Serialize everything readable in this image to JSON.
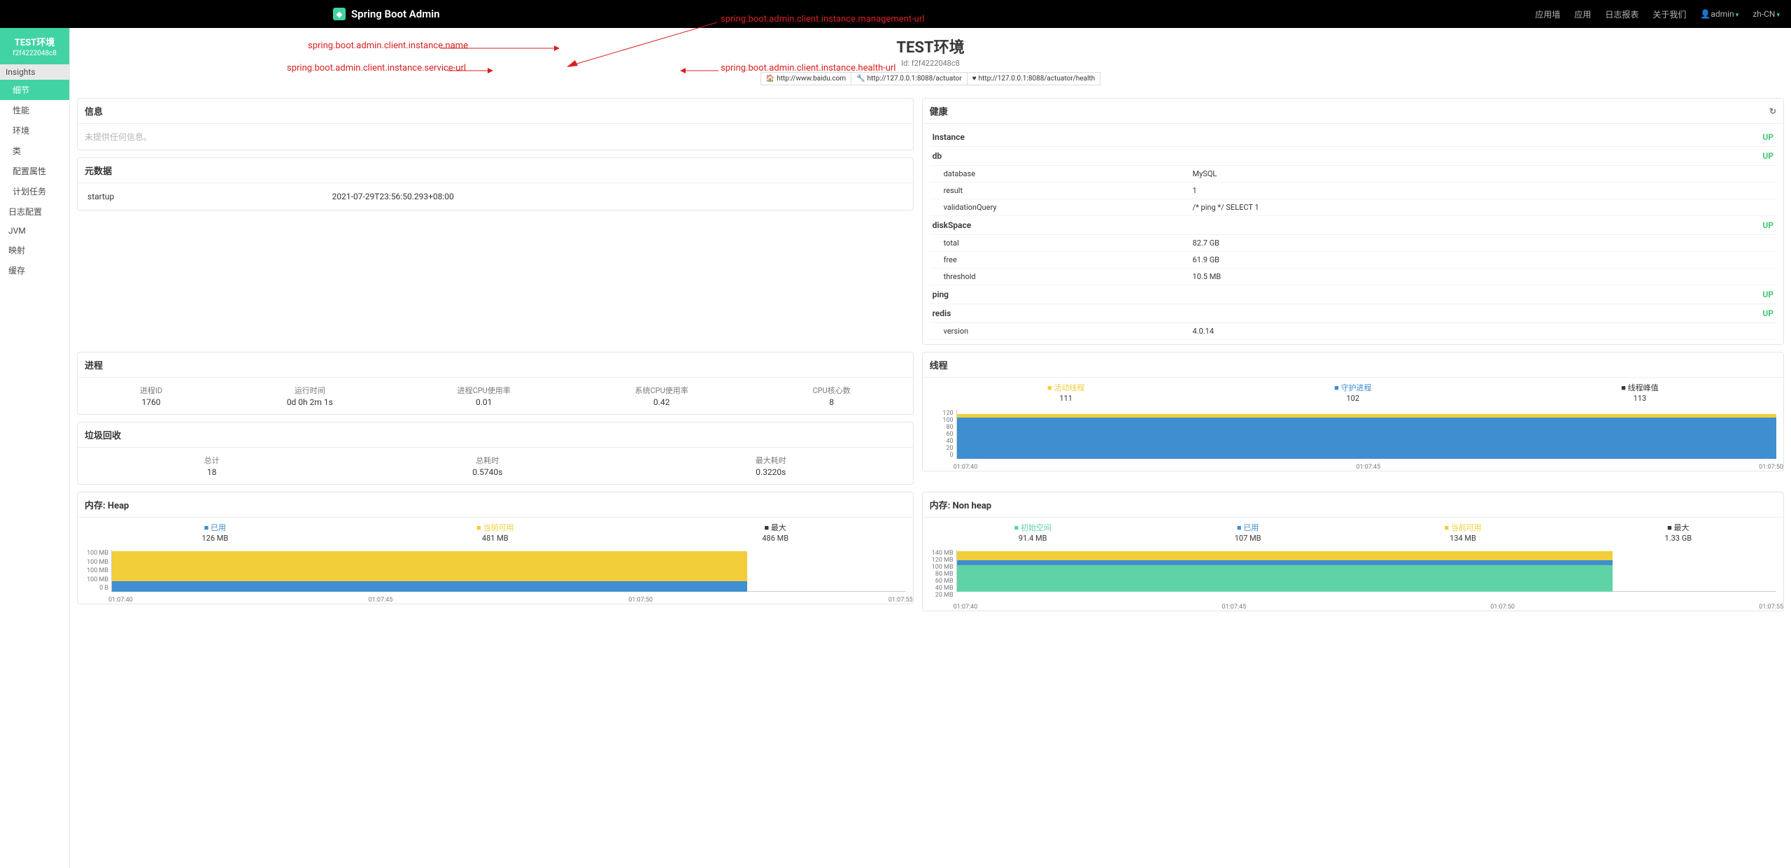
{
  "navbar": {
    "brand": "Spring Boot Admin",
    "items": [
      "应用墙",
      "应用",
      "日志报表",
      "关于我们"
    ],
    "user": "admin",
    "lang": "zh-CN"
  },
  "sidebar": {
    "app_title": "TEST环境",
    "app_id": "f2f4222048c8",
    "section": "Insights",
    "items": [
      "细节",
      "性能",
      "环境",
      "类",
      "配置属性",
      "计划任务",
      "日志配置",
      "JVM",
      "映射",
      "缓存"
    ]
  },
  "header": {
    "title": "TEST环境",
    "sub": "Id: f2f4222048c8",
    "urls": {
      "service": "http://www.baidu.com",
      "management": "http://127.0.0.1:8088/actuator",
      "health": "http://127.0.0.1:8088/actuator/health"
    }
  },
  "annotations": {
    "name": "spring.boot.admin.client.instance.name",
    "service": "spring.boot.admin.client.instance.service-url",
    "management": "spring.boot.admin.client.instance.management-url",
    "health": "spring.boot.admin.client.instance.health-url"
  },
  "cards": {
    "info": {
      "title": "信息",
      "empty": "未提供任何信息。"
    },
    "meta": {
      "title": "元数据",
      "rows": [
        {
          "k": "startup",
          "v": "2021-07-29T23:56:50.293+08:00"
        }
      ]
    },
    "health": {
      "title": "健康",
      "items": [
        {
          "name": "Instance",
          "status": "UP",
          "details": []
        },
        {
          "name": "db",
          "status": "UP",
          "details": [
            {
              "k": "database",
              "v": "MySQL"
            },
            {
              "k": "result",
              "v": "1"
            },
            {
              "k": "validationQuery",
              "v": "/* ping */ SELECT 1"
            }
          ]
        },
        {
          "name": "diskSpace",
          "status": "UP",
          "details": [
            {
              "k": "total",
              "v": "82.7 GB"
            },
            {
              "k": "free",
              "v": "61.9 GB"
            },
            {
              "k": "threshold",
              "v": "10.5 MB"
            }
          ]
        },
        {
          "name": "ping",
          "status": "UP",
          "details": []
        },
        {
          "name": "redis",
          "status": "UP",
          "details": [
            {
              "k": "version",
              "v": "4.0.14"
            }
          ]
        }
      ]
    },
    "process": {
      "title": "进程",
      "stats": [
        {
          "lbl": "进程ID",
          "val": "1760"
        },
        {
          "lbl": "运行时间",
          "val": "0d 0h 2m 1s"
        },
        {
          "lbl": "进程CPU使用率",
          "val": "0.01"
        },
        {
          "lbl": "系统CPU使用率",
          "val": "0.42"
        },
        {
          "lbl": "CPU核心数",
          "val": "8"
        }
      ]
    },
    "gc": {
      "title": "垃圾回收",
      "stats": [
        {
          "lbl": "总计",
          "val": "18"
        },
        {
          "lbl": "总耗时",
          "val": "0.5740s"
        },
        {
          "lbl": "最大耗时",
          "val": "0.3220s"
        }
      ]
    },
    "threads": {
      "title": "线程",
      "legend": [
        {
          "name": "活动线程",
          "val": "111",
          "color": "#f2ce3a"
        },
        {
          "name": "守护进程",
          "val": "102",
          "color": "#3e8ed0"
        },
        {
          "name": "线程峰值",
          "val": "113",
          "color": "#363636"
        }
      ]
    },
    "heap": {
      "title": "内存: Heap",
      "legend": [
        {
          "name": "已用",
          "val": "126 MB",
          "color": "#3e8ed0"
        },
        {
          "name": "当前可用",
          "val": "481 MB",
          "color": "#f2ce3a"
        },
        {
          "name": "最大",
          "val": "486 MB",
          "color": "#363636"
        }
      ]
    },
    "nonheap": {
      "title": "内存: Non heap",
      "legend": [
        {
          "name": "初始空间",
          "val": "91.4 MB",
          "color": "#5fd3a5"
        },
        {
          "name": "已用",
          "val": "107 MB",
          "color": "#3e8ed0"
        },
        {
          "name": "当前可用",
          "val": "134 MB",
          "color": "#f2ce3a"
        },
        {
          "name": "最大",
          "val": "1.33 GB",
          "color": "#363636"
        }
      ]
    }
  },
  "chart_data": [
    {
      "type": "area",
      "title": "线程",
      "x": [
        "01:07:40",
        "01:07:45",
        "01:07:50"
      ],
      "series": [
        {
          "name": "活动线程",
          "values": [
            111,
            111,
            111
          ]
        },
        {
          "name": "守护进程",
          "values": [
            102,
            102,
            102
          ]
        }
      ],
      "ylim": [
        0,
        120
      ],
      "yticks": [
        0,
        20,
        40,
        60,
        80,
        100,
        120
      ]
    },
    {
      "type": "area",
      "title": "内存: Heap",
      "x": [
        "01:07:40",
        "01:07:45",
        "01:07:50",
        "01:07:55"
      ],
      "series": [
        {
          "name": "已用",
          "unit": "MB",
          "values": [
            126,
            126,
            126,
            126
          ]
        },
        {
          "name": "当前可用",
          "unit": "MB",
          "values": [
            481,
            481,
            481,
            481
          ]
        }
      ],
      "ylim": [
        0,
        120
      ],
      "yticks": [
        "0 B",
        "100 MB",
        "100 MB",
        "100 MB",
        "100 MB"
      ]
    },
    {
      "type": "area",
      "title": "内存: Non heap",
      "x": [
        "01:07:40",
        "01:07:45",
        "01:07:50",
        "01:07:55"
      ],
      "series": [
        {
          "name": "初始空间",
          "unit": "MB",
          "values": [
            91.4,
            91.4,
            91.4,
            91.4
          ]
        },
        {
          "name": "已用",
          "unit": "MB",
          "values": [
            107,
            107,
            107,
            107
          ]
        },
        {
          "name": "当前可用",
          "unit": "MB",
          "values": [
            134,
            134,
            134,
            134
          ]
        }
      ],
      "ylim": [
        0,
        160
      ],
      "yticks": [
        "20 MB",
        "40 MB",
        "60 MB",
        "80 MB",
        "100 MB",
        "120 MB",
        "140 MB"
      ]
    }
  ]
}
